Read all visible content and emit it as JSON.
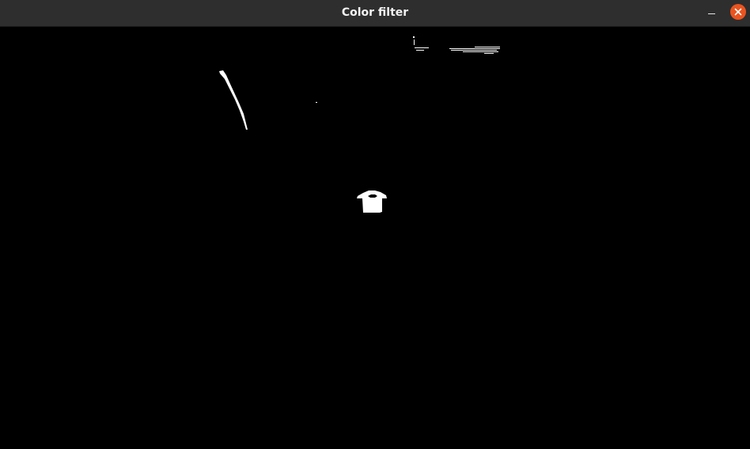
{
  "window": {
    "title": "Color filter"
  },
  "controls": {
    "minimize_icon": "minimize-icon",
    "close_icon": "close-icon",
    "close_color": "#e95420"
  },
  "canvas": {
    "background": "#000000",
    "mask_color": "#ffffff"
  }
}
